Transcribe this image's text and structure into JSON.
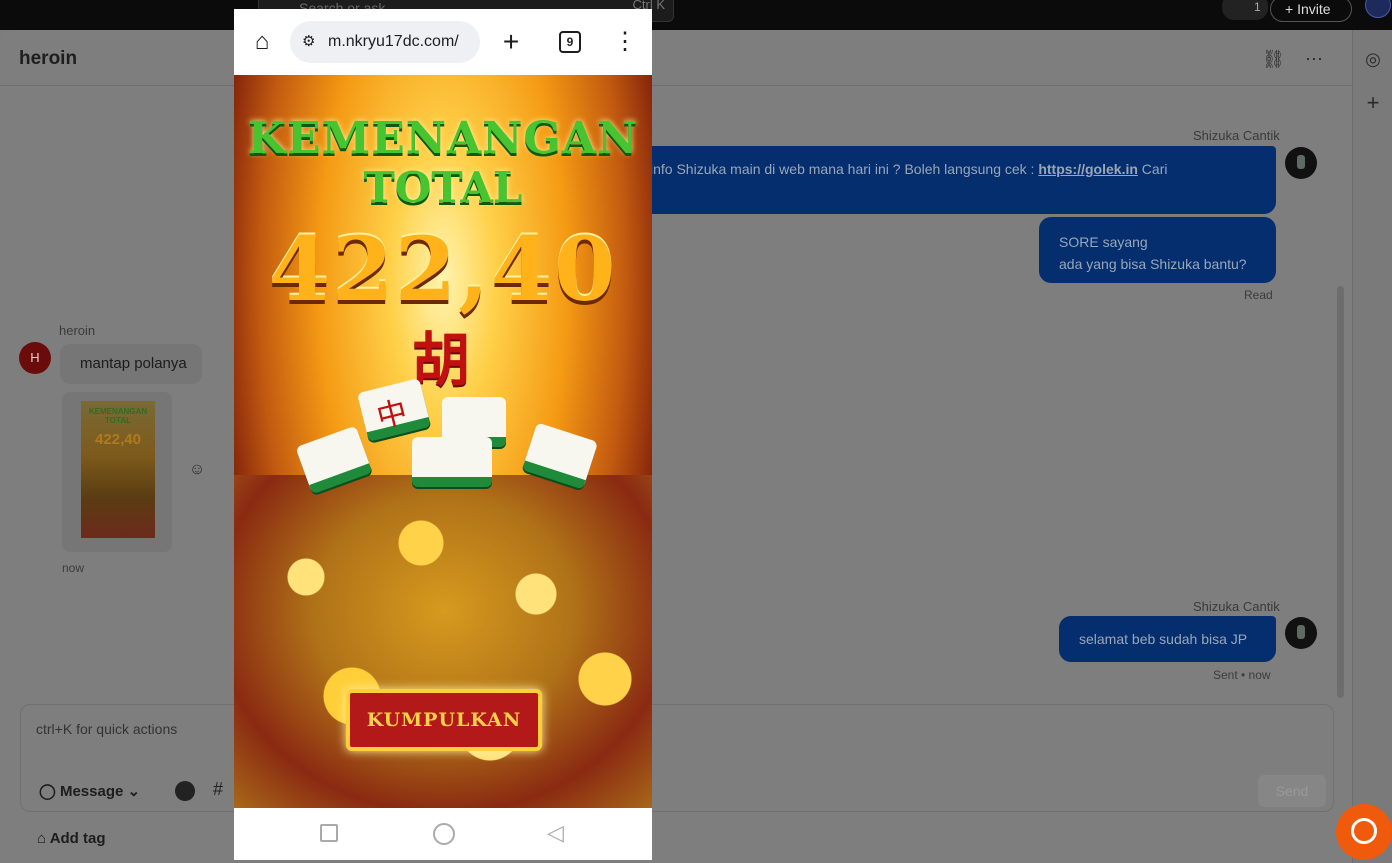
{
  "topbar": {
    "search_placeholder": "Search or ask",
    "search_shortcut": "Ctrl  K",
    "member_count": "1",
    "invite_label": "Invite"
  },
  "header": {
    "title": "heroin"
  },
  "messages": {
    "incoming": {
      "sender": "heroin",
      "avatar_letter": "H",
      "text": "mantap polanya",
      "thumb_title": "KEMENANGAN TOTAL",
      "thumb_amount": "422,40",
      "time": "now"
    },
    "outgoing_1": {
      "sender": "Shizuka Cantik",
      "text_before_link": "info Shizuka main di web mana hari ini ? Boleh langsung cek : ",
      "link": "https://golek.in",
      "text_after_link": " Cari"
    },
    "outgoing_2": {
      "line1": "SORE sayang",
      "line2": "ada yang bisa Shizuka bantu?",
      "status": "Read"
    },
    "outgoing_3": {
      "sender": "Shizuka Cantik",
      "text": "selamat beb sudah bisa JP",
      "status": "Sent • now"
    }
  },
  "composer": {
    "placeholder": "ctrl+K for quick actions",
    "mode_label": "Message",
    "send_label": "Send",
    "add_tag_label": "Add tag"
  },
  "phone": {
    "url": "m.nkryu17dc.com/",
    "tab_count": "9",
    "game": {
      "title_line1": "KEMENANGAN",
      "title_line2": "TOTAL",
      "amount": "422,40",
      "hanzi": "胡",
      "tile_char": "中",
      "button_label": "KUMPULKAN"
    }
  },
  "colors": {
    "bubble_out": "#042e6e",
    "avatar_h": "#6b0c0c",
    "chat_widget": "#f05a0c",
    "game_green": "#48c431"
  }
}
